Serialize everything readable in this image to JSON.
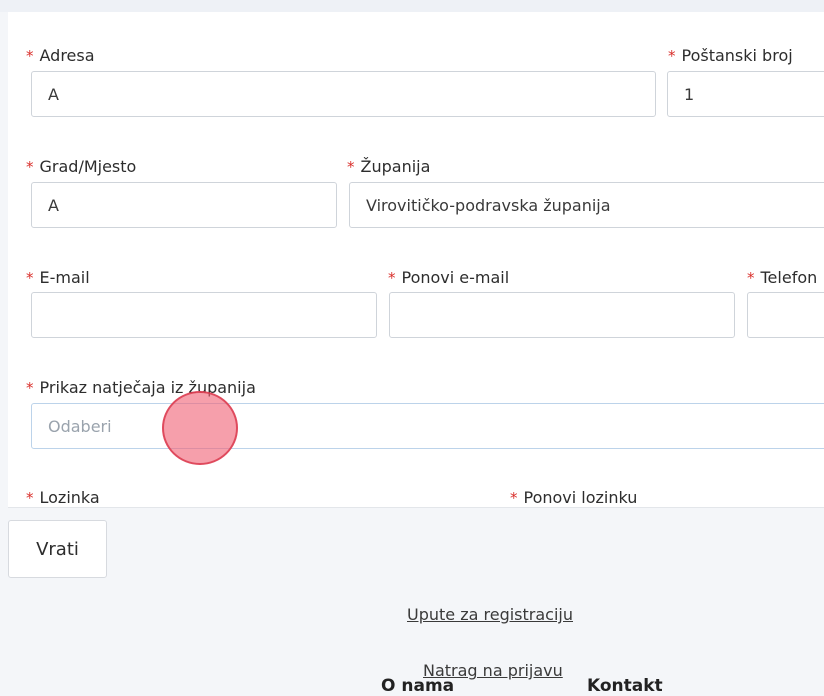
{
  "form": {
    "address": {
      "label": "Adresa",
      "value": "A"
    },
    "postal": {
      "label": "Poštanski broj",
      "value": "1"
    },
    "city": {
      "label": "Grad/Mjesto",
      "value": "A"
    },
    "county": {
      "label": "Županija",
      "value": "Virovitičko-podravska županija"
    },
    "email": {
      "label": "E-mail",
      "value": ""
    },
    "email_repeat": {
      "label": "Ponovi e-mail",
      "value": ""
    },
    "phone": {
      "label": "Telefon",
      "value": ""
    },
    "tender_counties": {
      "label": "Prikaz natječaja iz županija",
      "placeholder": "Odaberi"
    },
    "password": {
      "label": "Lozinka"
    },
    "password_repeat": {
      "label": "Ponovi lozinku"
    },
    "required_mark": "*"
  },
  "actions": {
    "back_label": "Vrati"
  },
  "links": {
    "registration_help": "Upute za registraciju",
    "back_to_login": "Natrag na prijavu"
  },
  "footer": {
    "about": "O nama",
    "contact": "Kontakt"
  },
  "colors": {
    "required": "#d9302c",
    "touch_indicator": "#f06478"
  }
}
